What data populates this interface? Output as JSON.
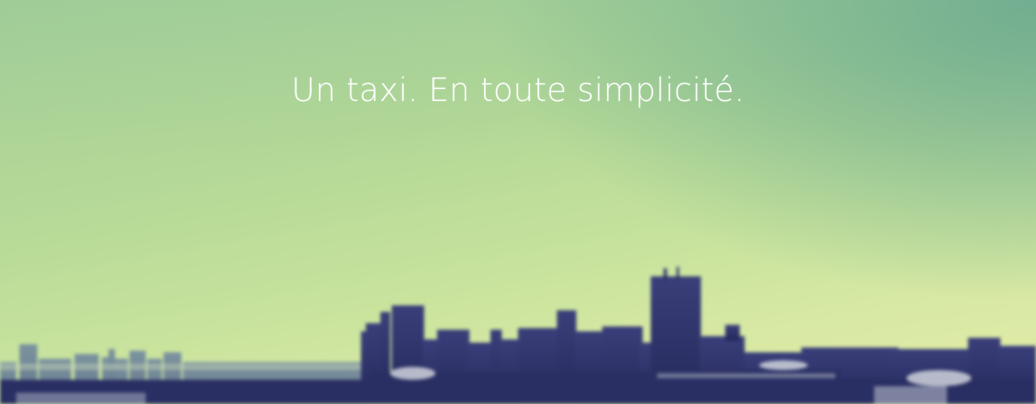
{
  "hero": {
    "tagline": "Un taxi. En toute simplicité."
  },
  "colors": {
    "sky_top_right": "#4f9690",
    "sky_mid": "#b3d897",
    "sky_horizon": "#e2eba8",
    "skyline_dark": "#2c3268",
    "skyline_mid": "#4a4f88",
    "text": "#ffffff"
  }
}
